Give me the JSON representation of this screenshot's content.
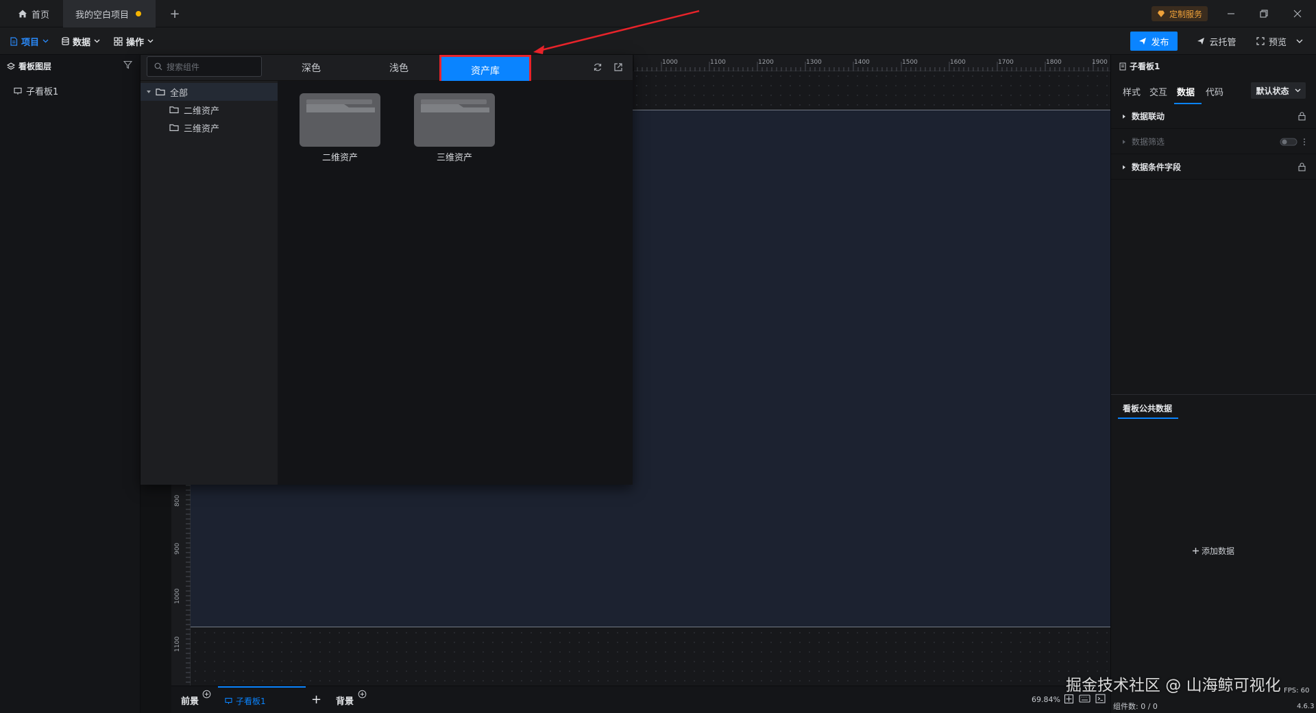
{
  "titlebar": {
    "tabs": [
      {
        "label": "首页"
      },
      {
        "label": "我的空白项目"
      }
    ],
    "custom_service": "定制服务"
  },
  "toolbar": {
    "menus": [
      {
        "label": "项目"
      },
      {
        "label": "数据"
      },
      {
        "label": "操作"
      }
    ],
    "publish": "发布",
    "cloud_hosting": "云托管",
    "preview": "预览"
  },
  "layers": {
    "title": "看板图层",
    "items": [
      {
        "label": "子看板1"
      }
    ]
  },
  "asset_popup": {
    "search_placeholder": "搜索组件",
    "tabs": [
      {
        "label": "深色"
      },
      {
        "label": "浅色"
      },
      {
        "label": "资产库"
      }
    ],
    "active_tab": "资产库",
    "tree": [
      {
        "label": "全部"
      },
      {
        "label": "二维资产"
      },
      {
        "label": "三维资产"
      }
    ],
    "folders": [
      {
        "label": "二维资产"
      },
      {
        "label": "三维资产"
      }
    ]
  },
  "ruler": {
    "top_ticks": [
      "1000",
      "1100",
      "1200",
      "1300",
      "1400",
      "1500",
      "1600",
      "1700",
      "1800",
      "1900"
    ],
    "left_ticks": [
      "800",
      "900",
      "1000",
      "1100"
    ]
  },
  "right_panel": {
    "title": "子看板1",
    "tabs": [
      {
        "label": "样式"
      },
      {
        "label": "交互"
      },
      {
        "label": "数据"
      },
      {
        "label": "代码"
      }
    ],
    "active_tab": "数据",
    "state_select": "默认状态",
    "sections": [
      {
        "label": "数据联动"
      },
      {
        "label": "数据筛选"
      },
      {
        "label": "数据条件字段"
      }
    ],
    "public_tab": "看板公共数据",
    "add_data": "添加数据"
  },
  "bottombar": {
    "foreground": "前景",
    "sub_board": "子看板1",
    "background": "背景",
    "zoom": "69.84%",
    "component_count": "组件数: 0 / 0",
    "fps": "FPS: 60",
    "version": "4.6.3"
  },
  "watermark": "掘金技术社区 @ 山海鲸可视化",
  "colors": {
    "accent": "#0a84ff",
    "highlight_border": "#e8232a",
    "arrow": "#e8232a"
  }
}
